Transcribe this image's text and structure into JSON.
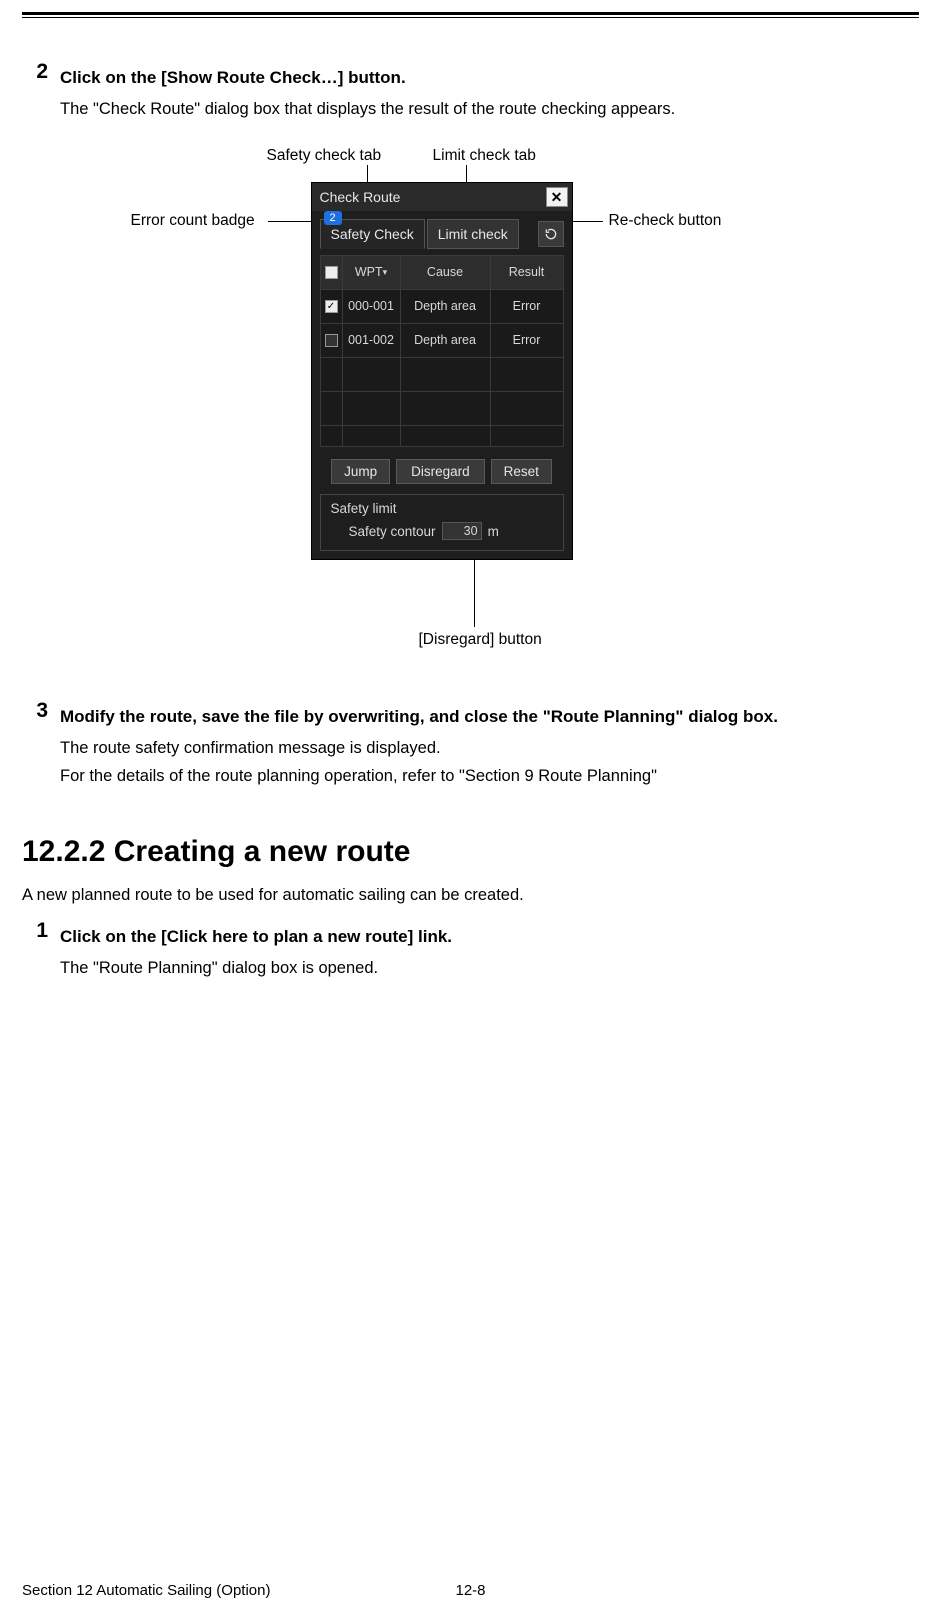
{
  "step2": {
    "num": "2",
    "title": "Click on the [Show Route Check…] button.",
    "text": "The \"Check Route\" dialog box that displays the result of the route checking appears."
  },
  "callouts": {
    "safety_tab": "Safety check tab",
    "limit_tab": "Limit check tab",
    "error_badge": "Error count badge",
    "recheck": "Re-check button",
    "disregard": "[Disregard] button"
  },
  "dialog": {
    "title": "Check Route",
    "close": "✕",
    "badge": "2",
    "tab_safety": "Safety Check",
    "tab_limit": "Limit check",
    "headers": {
      "wpt": "WPT",
      "cause": "Cause",
      "result": "Result"
    },
    "rows": [
      {
        "checked": true,
        "wpt": "000-001",
        "cause": "Depth area",
        "result": "Error"
      },
      {
        "checked": false,
        "wpt": "001-002",
        "cause": "Depth area",
        "result": "Error"
      }
    ],
    "buttons": {
      "jump": "Jump",
      "disregard": "Disregard",
      "reset": "Reset"
    },
    "safety_limit": {
      "title": "Safety limit",
      "label": "Safety contour",
      "value": "30",
      "unit": "m"
    }
  },
  "step3": {
    "num": "3",
    "title": "Modify the route, save the file by overwriting, and close the \"Route Planning\" dialog box.",
    "line1": "The route safety confirmation message is displayed.",
    "line2": "For the details of the route planning operation, refer to \"Section 9 Route Planning\""
  },
  "heading": "12.2.2   Creating a new route",
  "heading_sub": "A new planned route to be used for automatic sailing can be created.",
  "step1b": {
    "num": "1",
    "title": "Click on the [Click here to plan a new route] link.",
    "text": "The \"Route Planning\" dialog box is opened."
  },
  "footer": {
    "left": "Section 12    Automatic Sailing (Option)",
    "mid": "12-8"
  }
}
